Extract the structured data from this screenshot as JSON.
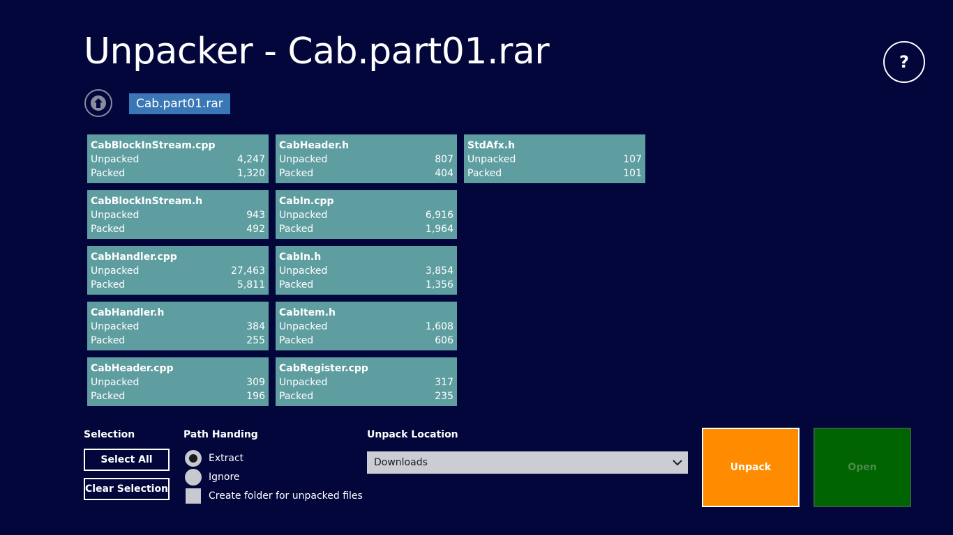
{
  "header": {
    "title": "Unpacker - Cab.part01.rar",
    "help_label": "?"
  },
  "breadcrumb": {
    "current": "Cab.part01.rar"
  },
  "files": [
    {
      "name": "CabBlockInStream.cpp",
      "unpacked_label": "Unpacked",
      "unpacked": "4,247",
      "packed_label": "Packed",
      "packed": "1,320"
    },
    {
      "name": "CabBlockInStream.h",
      "unpacked_label": "Unpacked",
      "unpacked": "943",
      "packed_label": "Packed",
      "packed": "492"
    },
    {
      "name": "CabHandler.cpp",
      "unpacked_label": "Unpacked",
      "unpacked": "27,463",
      "packed_label": "Packed",
      "packed": "5,811"
    },
    {
      "name": "CabHandler.h",
      "unpacked_label": "Unpacked",
      "unpacked": "384",
      "packed_label": "Packed",
      "packed": "255"
    },
    {
      "name": "CabHeader.cpp",
      "unpacked_label": "Unpacked",
      "unpacked": "309",
      "packed_label": "Packed",
      "packed": "196"
    },
    {
      "name": "CabHeader.h",
      "unpacked_label": "Unpacked",
      "unpacked": "807",
      "packed_label": "Packed",
      "packed": "404"
    },
    {
      "name": "CabIn.cpp",
      "unpacked_label": "Unpacked",
      "unpacked": "6,916",
      "packed_label": "Packed",
      "packed": "1,964"
    },
    {
      "name": "CabIn.h",
      "unpacked_label": "Unpacked",
      "unpacked": "3,854",
      "packed_label": "Packed",
      "packed": "1,356"
    },
    {
      "name": "CabItem.h",
      "unpacked_label": "Unpacked",
      "unpacked": "1,608",
      "packed_label": "Packed",
      "packed": "606"
    },
    {
      "name": "CabRegister.cpp",
      "unpacked_label": "Unpacked",
      "unpacked": "317",
      "packed_label": "Packed",
      "packed": "235"
    },
    {
      "name": "StdAfx.h",
      "unpacked_label": "Unpacked",
      "unpacked": "107",
      "packed_label": "Packed",
      "packed": "101"
    }
  ],
  "selection": {
    "label": "Selection",
    "select_all": "Select All",
    "clear_selection": "Clear Selection"
  },
  "path_handling": {
    "label": "Path Handing",
    "extract": "Extract",
    "ignore": "Ignore",
    "create_folder": "Create folder for unpacked files",
    "selected": "extract",
    "create_folder_checked": false
  },
  "location": {
    "label": "Unpack Location",
    "value": "Downloads"
  },
  "actions": {
    "unpack": "Unpack",
    "open": "Open",
    "open_enabled": false
  },
  "colors": {
    "background": "#02063a",
    "tile": "#5f9ea0",
    "breadcrumb": "#3a77b6",
    "unpack": "#ff8c00",
    "open": "#006400"
  }
}
